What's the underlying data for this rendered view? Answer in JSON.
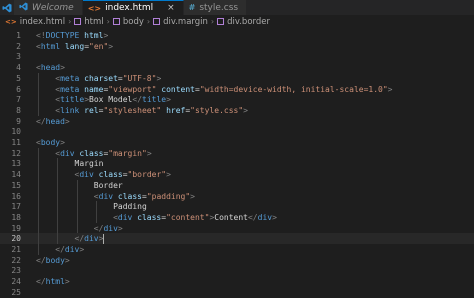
{
  "tabs": [
    {
      "label": "Welcome",
      "icon": "vscode-icon",
      "active": false
    },
    {
      "label": "index.html",
      "icon": "html-file-icon",
      "active": true,
      "close": "×"
    },
    {
      "label": "style.css",
      "icon": "css-file-icon",
      "active": false
    }
  ],
  "breadcrumb": [
    "index.html",
    "html",
    "body",
    "div.margin",
    "div.border"
  ],
  "current_line": 20,
  "lines": [
    {
      "n": "1",
      "tokens": [
        [
          "b",
          "<!"
        ],
        [
          "t",
          "DOCTYPE"
        ],
        [
          "a",
          " html"
        ],
        [
          "b",
          ">"
        ]
      ]
    },
    {
      "n": "2",
      "tokens": [
        [
          "b",
          "<"
        ],
        [
          "t",
          "html"
        ],
        [
          "a",
          " lang"
        ],
        [
          "x",
          "="
        ],
        [
          "s",
          "\"en\""
        ],
        [
          "b",
          ">"
        ]
      ]
    },
    {
      "n": "3",
      "tokens": []
    },
    {
      "n": "4",
      "tokens": [
        [
          "b",
          "<"
        ],
        [
          "t",
          "head"
        ],
        [
          "b",
          ">"
        ]
      ]
    },
    {
      "n": "5",
      "tokens": [
        [
          "x",
          "    "
        ],
        [
          "b",
          "<"
        ],
        [
          "t",
          "meta"
        ],
        [
          "a",
          " charset"
        ],
        [
          "x",
          "="
        ],
        [
          "s",
          "\"UTF-8\""
        ],
        [
          "b",
          ">"
        ]
      ]
    },
    {
      "n": "6",
      "tokens": [
        [
          "x",
          "    "
        ],
        [
          "b",
          "<"
        ],
        [
          "t",
          "meta"
        ],
        [
          "a",
          " name"
        ],
        [
          "x",
          "="
        ],
        [
          "s",
          "\"viewport\""
        ],
        [
          "a",
          " content"
        ],
        [
          "x",
          "="
        ],
        [
          "s",
          "\"width=device-width, initial-scale=1.0\""
        ],
        [
          "b",
          ">"
        ]
      ]
    },
    {
      "n": "7",
      "tokens": [
        [
          "x",
          "    "
        ],
        [
          "b",
          "<"
        ],
        [
          "t",
          "title"
        ],
        [
          "b",
          ">"
        ],
        [
          "x",
          "Box Model"
        ],
        [
          "b",
          "</"
        ],
        [
          "t",
          "title"
        ],
        [
          "b",
          ">"
        ]
      ]
    },
    {
      "n": "8",
      "tokens": [
        [
          "x",
          "    "
        ],
        [
          "b",
          "<"
        ],
        [
          "t",
          "link"
        ],
        [
          "a",
          " rel"
        ],
        [
          "x",
          "="
        ],
        [
          "s",
          "\"stylesheet\""
        ],
        [
          "a",
          " href"
        ],
        [
          "x",
          "="
        ],
        [
          "s",
          "\"style.css\""
        ],
        [
          "b",
          ">"
        ]
      ]
    },
    {
      "n": "9",
      "tokens": [
        [
          "b",
          "</"
        ],
        [
          "t",
          "head"
        ],
        [
          "b",
          ">"
        ]
      ]
    },
    {
      "n": "10",
      "tokens": []
    },
    {
      "n": "11",
      "tokens": [
        [
          "b",
          "<"
        ],
        [
          "t",
          "body"
        ],
        [
          "b",
          ">"
        ]
      ]
    },
    {
      "n": "12",
      "tokens": [
        [
          "x",
          "    "
        ],
        [
          "b",
          "<"
        ],
        [
          "t",
          "div"
        ],
        [
          "a",
          " class"
        ],
        [
          "x",
          "="
        ],
        [
          "s",
          "\"margin\""
        ],
        [
          "b",
          ">"
        ]
      ]
    },
    {
      "n": "13",
      "tokens": [
        [
          "x",
          "        Margin"
        ]
      ]
    },
    {
      "n": "14",
      "tokens": [
        [
          "x",
          "        "
        ],
        [
          "b",
          "<"
        ],
        [
          "t",
          "div"
        ],
        [
          "a",
          " class"
        ],
        [
          "x",
          "="
        ],
        [
          "s",
          "\"border\""
        ],
        [
          "b",
          ">"
        ]
      ]
    },
    {
      "n": "15",
      "tokens": [
        [
          "x",
          "            Border"
        ]
      ]
    },
    {
      "n": "16",
      "tokens": [
        [
          "x",
          "            "
        ],
        [
          "b",
          "<"
        ],
        [
          "t",
          "div"
        ],
        [
          "a",
          " class"
        ],
        [
          "x",
          "="
        ],
        [
          "s",
          "\"padding\""
        ],
        [
          "b",
          ">"
        ]
      ]
    },
    {
      "n": "17",
      "tokens": [
        [
          "x",
          "                Padding"
        ]
      ]
    },
    {
      "n": "18",
      "tokens": [
        [
          "x",
          "                "
        ],
        [
          "b",
          "<"
        ],
        [
          "t",
          "div"
        ],
        [
          "a",
          " class"
        ],
        [
          "x",
          "="
        ],
        [
          "s",
          "\"content\""
        ],
        [
          "b",
          ">"
        ],
        [
          "x",
          "Content"
        ],
        [
          "b",
          "</"
        ],
        [
          "t",
          "div"
        ],
        [
          "b",
          ">"
        ]
      ]
    },
    {
      "n": "19",
      "tokens": [
        [
          "x",
          "            "
        ],
        [
          "b",
          "</"
        ],
        [
          "t",
          "div"
        ],
        [
          "b",
          ">"
        ]
      ]
    },
    {
      "n": "20",
      "tokens": [
        [
          "x",
          "        "
        ],
        [
          "b",
          "</"
        ],
        [
          "t",
          "div"
        ],
        [
          "b",
          ">"
        ]
      ]
    },
    {
      "n": "21",
      "tokens": [
        [
          "x",
          "    "
        ],
        [
          "b",
          "</"
        ],
        [
          "t",
          "div"
        ],
        [
          "b",
          ">"
        ]
      ]
    },
    {
      "n": "22",
      "tokens": [
        [
          "b",
          "</"
        ],
        [
          "t",
          "body"
        ],
        [
          "b",
          ">"
        ]
      ]
    },
    {
      "n": "23",
      "tokens": []
    },
    {
      "n": "24",
      "tokens": [
        [
          "b",
          "</"
        ],
        [
          "t",
          "html"
        ],
        [
          "b",
          ">"
        ]
      ]
    },
    {
      "n": "25",
      "tokens": []
    }
  ]
}
